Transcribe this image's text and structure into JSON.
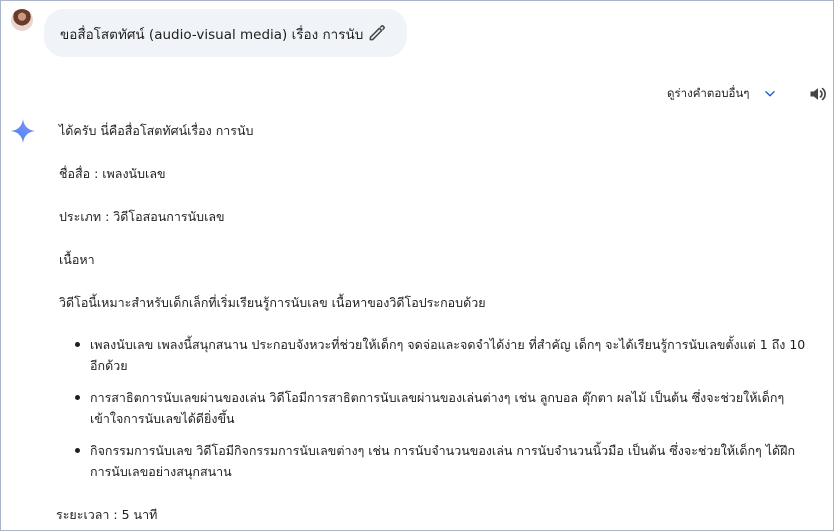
{
  "prompt": {
    "text": "ขอสื่อโสตทัศน์ (audio-visual media) เรื่อง การนับ"
  },
  "toolbar": {
    "drafts_label": "ดูร่างคำตอบอื่นๆ"
  },
  "icons": {
    "edit": "pencil-icon",
    "drafts_toggle": "chevron-down-icon",
    "read_aloud": "speaker-icon",
    "assistant": "sparkle-icon",
    "accent_color": "#4285f4"
  },
  "response": {
    "intro": "ได้ครับ นี่คือสื่อโสตทัศน์เรื่อง การนับ",
    "name_line": "ชื่อสื่อ : เพลงนับเลข",
    "type_line": "ประเภท : วิดีโอสอนการนับเลข",
    "content_heading": "เนื้อหา",
    "summary": "วิดีโอนี้เหมาะสำหรับเด็กเล็กที่เริ่มเรียนรู้การนับเลข เนื้อหาของวิดีโอประกอบด้วย",
    "items": [
      "เพลงนับเลข เพลงนี้สนุกสนาน ประกอบจังหวะที่ช่วยให้เด็กๆ จดจ่อและจดจำได้ง่าย ที่สำคัญ เด็กๆ จะได้เรียนรู้การนับเลขตั้งแต่ 1 ถึง 10 อีกด้วย",
      "การสาธิตการนับเลขผ่านของเล่น วิดีโอมีการสาธิตการนับเลขผ่านของเล่นต่างๆ เช่น ลูกบอล ตุ๊กตา ผลไม้ เป็นต้น ซึ่งจะช่วยให้เด็กๆ เข้าใจการนับเลขได้ดียิ่งขึ้น",
      "กิจกรรมการนับเลข วิดีโอมีกิจกรรมการนับเลขต่างๆ เช่น การนับจำนวนของเล่น การนับจำนวนนิ้วมือ เป็นต้น ซึ่งจะช่วยให้เด็กๆ ได้ฝึกการนับเลขอย่างสนุกสนาน"
    ],
    "duration_line": "ระยะเวลา : 5 นาที"
  }
}
